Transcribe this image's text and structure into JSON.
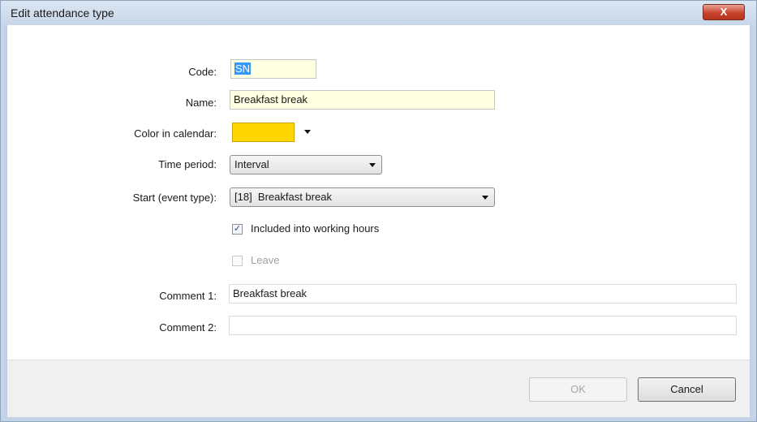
{
  "window": {
    "title": "Edit attendance type",
    "close_glyph": "X"
  },
  "form": {
    "code": {
      "label": "Code:",
      "value": "SN"
    },
    "name": {
      "label": "Name:",
      "value": "Breakfast break"
    },
    "color": {
      "label": "Color in calendar:",
      "value": "#ffd700"
    },
    "time_period": {
      "label": "Time period:",
      "value": "Interval"
    },
    "start_event": {
      "label": "Start (event type):",
      "value": "[18]  Breakfast break"
    },
    "included_working_hours": {
      "label": "Included into working hours",
      "checked": true
    },
    "leave": {
      "label": "Leave",
      "checked": false,
      "enabled": false
    },
    "comment1": {
      "label": "Comment 1:",
      "value": "Breakfast break"
    },
    "comment2": {
      "label": "Comment 2:",
      "value": ""
    }
  },
  "buttons": {
    "ok": "OK",
    "cancel": "Cancel"
  }
}
